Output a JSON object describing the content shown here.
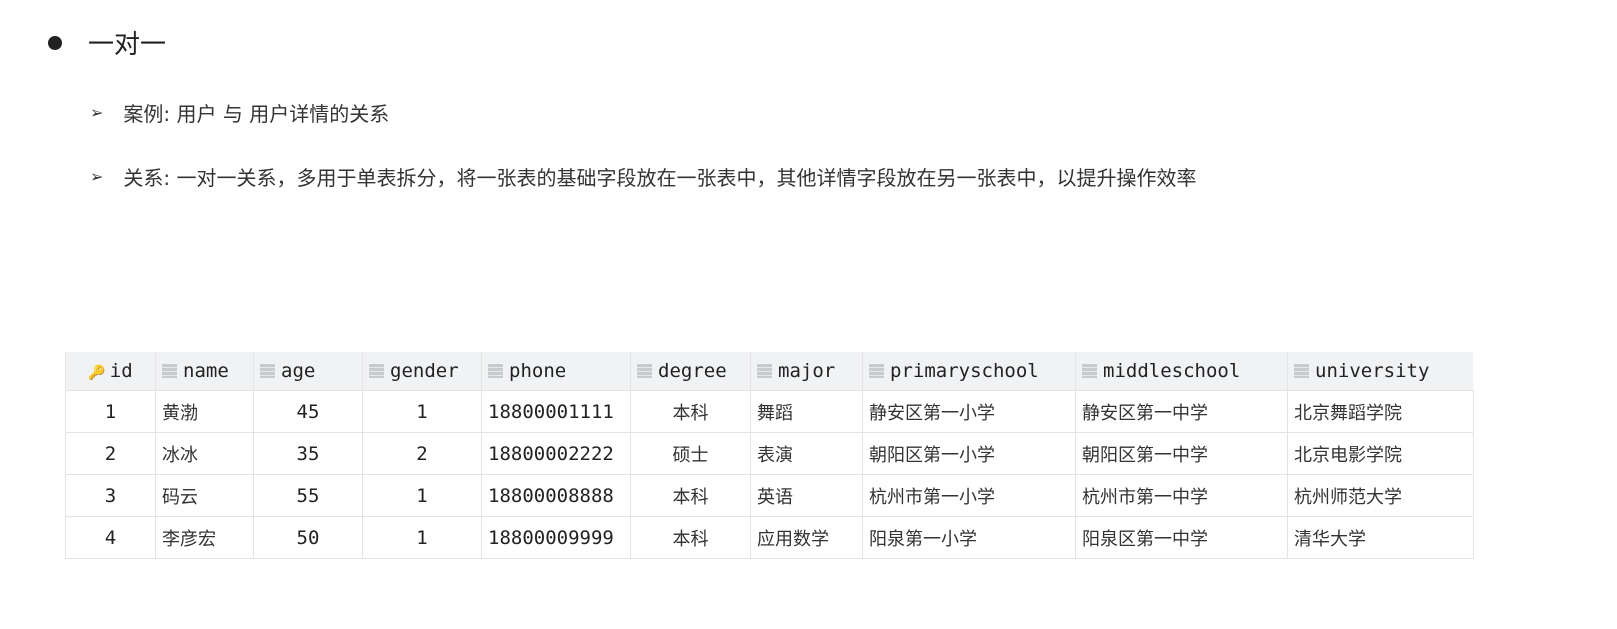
{
  "title": "一对一",
  "bullets": [
    "案例: 用户 与 用户详情的关系",
    "关系: 一对一关系，多用于单表拆分，将一张表的基础字段放在一张表中，其他详情字段放在另一张表中，以提升操作效率"
  ],
  "table": {
    "columns": [
      "id",
      "name",
      "age",
      "gender",
      "phone",
      "degree",
      "major",
      "primaryschool",
      "middleschool",
      "university"
    ],
    "rows": [
      [
        "1",
        "黄渤",
        "45",
        "1",
        "18800001111",
        "本科",
        "舞蹈",
        "静安区第一小学",
        "静安区第一中学",
        "北京舞蹈学院"
      ],
      [
        "2",
        "冰冰",
        "35",
        "2",
        "18800002222",
        "硕士",
        "表演",
        "朝阳区第一小学",
        "朝阳区第一中学",
        "北京电影学院"
      ],
      [
        "3",
        "码云",
        "55",
        "1",
        "18800008888",
        "本科",
        "英语",
        "杭州市第一小学",
        "杭州市第一中学",
        "杭州师范大学"
      ],
      [
        "4",
        "李彦宏",
        "50",
        "1",
        "18800009999",
        "本科",
        "应用数学",
        "阳泉第一小学",
        "阳泉区第一中学",
        "清华大学"
      ]
    ]
  }
}
